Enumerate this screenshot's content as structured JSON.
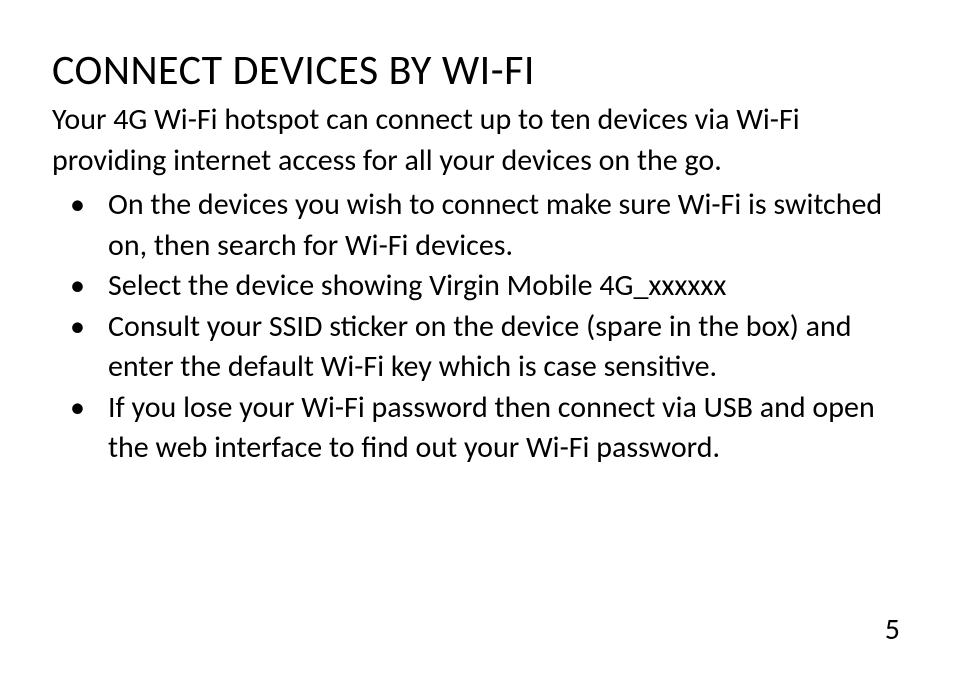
{
  "heading": "CONNECT DEVICES BY WI-FI",
  "intro": "Your 4G Wi-Fi hotspot can connect up to ten devices via Wi-Fi providing internet access for all your devices on the go.",
  "bullets": [
    "On the devices you wish to connect make sure Wi-Fi is switched on, then search for Wi-Fi devices.",
    "Select the device showing Virgin Mobile 4G_xxxxxx",
    "Consult your SSID sticker on the device (spare in the box) and enter the default Wi-Fi key which is case sensitive.",
    "If you lose your Wi-Fi password then connect via USB and open the web interface to find out your Wi-Fi password."
  ],
  "pageNumber": "5"
}
